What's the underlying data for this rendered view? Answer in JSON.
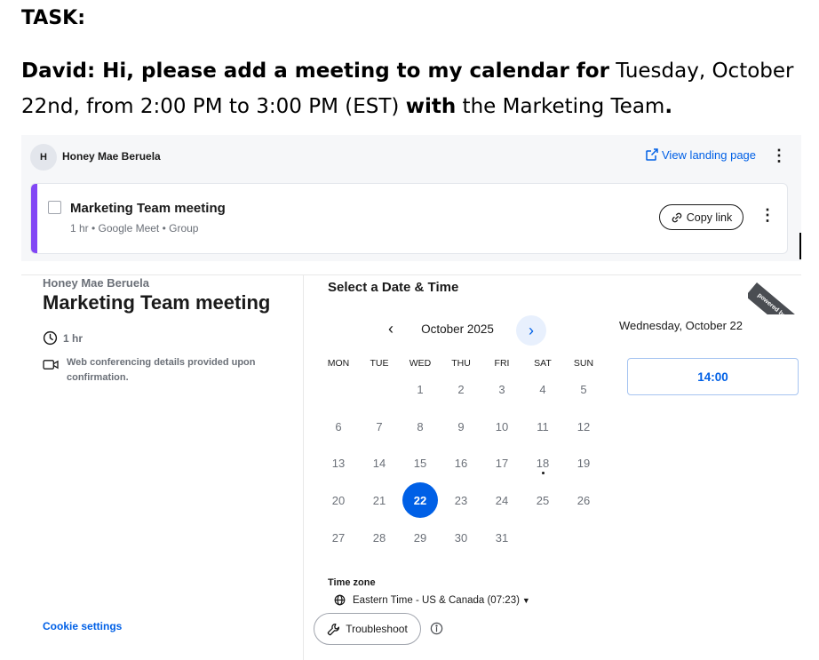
{
  "task": {
    "label": "TASK:",
    "speaker": "David:",
    "part1": " Hi, please add a meeting to my calendar for",
    "part2": " Tuesday, October 22nd, from 2:00 PM to 3:00 PM (EST) ",
    "part3": "with",
    "part4": " the Marketing Team",
    "part5": "."
  },
  "top_panel": {
    "avatar_initial": "H",
    "owner_name": "Honey Mae Beruela",
    "view_landing_label": "View landing page",
    "event": {
      "title": "Marketing Team meeting",
      "subtitle": "1 hr • Google Meet • Group",
      "copy_link_label": "Copy link",
      "accent_color": "#8247f5"
    }
  },
  "booking": {
    "owner_name": "Honey Mae Beruela",
    "event_title": "Marketing Team meeting",
    "duration": "1 hr",
    "conferencing_note": "Web conferencing details provided upon confirmation.",
    "cookie_settings": "Cookie settings",
    "ribbon_text": "powered by Calendly",
    "calendar": {
      "heading": "Select a Date & Time",
      "month": "October 2025",
      "weekdays": [
        "MON",
        "TUE",
        "WED",
        "THU",
        "FRI",
        "SAT",
        "SUN"
      ],
      "first_weekday_index": 2,
      "days_in_month": 31,
      "selected_day": 22,
      "today_day": 18,
      "prev_icon": "chevron-left-icon",
      "next_icon": "chevron-right-icon"
    },
    "timezone": {
      "label": "Time zone",
      "value": "Eastern Time - US & Canada (07:23)"
    },
    "troubleshoot_label": "Troubleshoot",
    "selected_date_label": "Wednesday, October 22",
    "time_slots": [
      "14:00"
    ],
    "colors": {
      "primary": "#0060e6",
      "primary_light": "#e8f0fd"
    }
  }
}
